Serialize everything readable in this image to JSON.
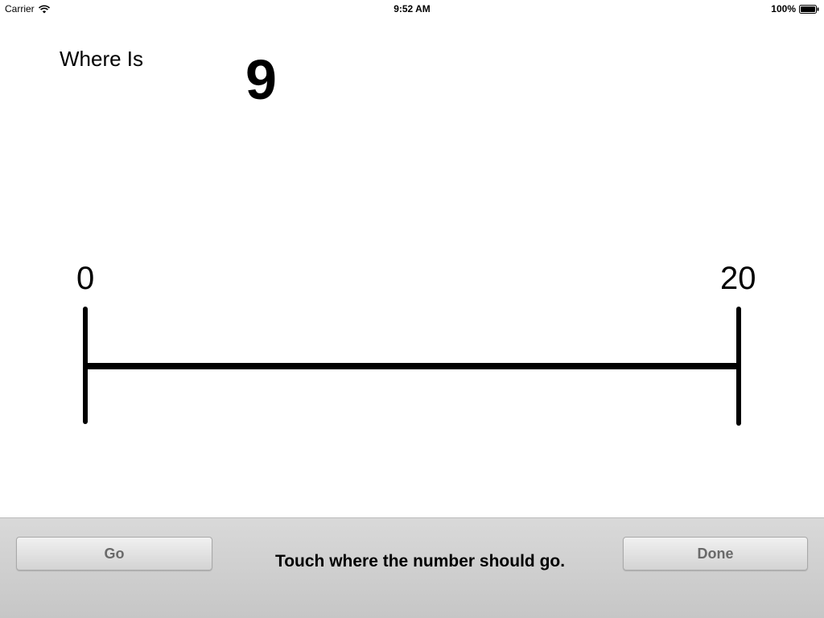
{
  "status_bar": {
    "carrier": "Carrier",
    "wifi_icon": "wifi-icon",
    "time": "9:52 AM",
    "battery_percent": "100%",
    "battery_icon": "battery-icon",
    "battery_level": 1.0
  },
  "prompt": {
    "label": "Where Is",
    "target": "9"
  },
  "number_line": {
    "start_label": "0",
    "end_label": "20",
    "min": 0,
    "max": 20
  },
  "toolbar": {
    "go_label": "Go",
    "instruction": "Touch where the number should go.",
    "done_label": "Done"
  }
}
